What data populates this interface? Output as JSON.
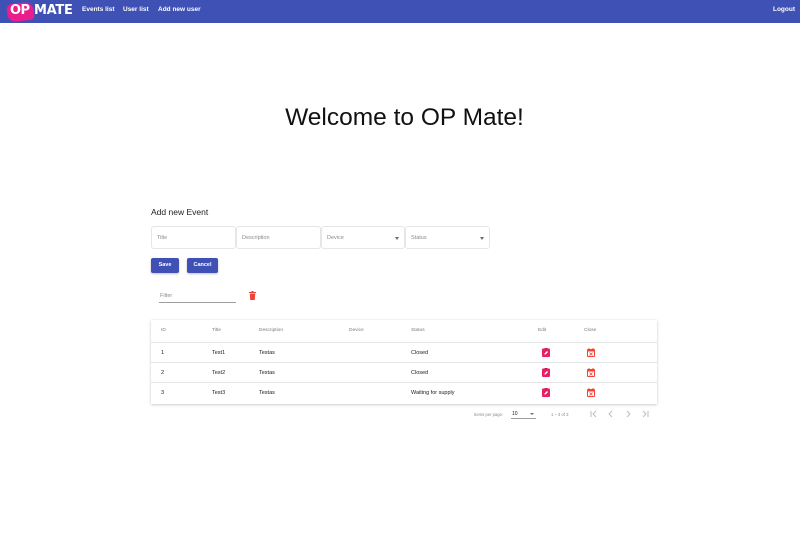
{
  "app": {
    "logo_op": "OP",
    "logo_mate": "MATE"
  },
  "nav": {
    "events_list": "Events list",
    "user_list": "User list",
    "add_new_user": "Add new user",
    "logout": "Logout"
  },
  "welcome": "Welcome to OP Mate!",
  "form": {
    "title": "Add new Event",
    "title_placeholder": "Title",
    "description_placeholder": "Description",
    "device_placeholder": "Device",
    "status_placeholder": "Status",
    "save_label": "Save",
    "cancel_label": "Cancel"
  },
  "filter": {
    "placeholder": "Filter"
  },
  "table": {
    "columns": {
      "id": "ID",
      "title": "Title",
      "description": "Description",
      "device": "Device",
      "status": "Status",
      "edit": "Edit",
      "close": "Close"
    },
    "rows": [
      {
        "id": "1",
        "title": "Test1",
        "description": "Testas",
        "device": "",
        "status": "Closed"
      },
      {
        "id": "2",
        "title": "Test2",
        "description": "Testas",
        "device": "",
        "status": "Closed"
      },
      {
        "id": "3",
        "title": "Test3",
        "description": "Testas",
        "device": "",
        "status": "Waiting for supply"
      }
    ]
  },
  "paginator": {
    "items_per_page_label": "Items per page:",
    "page_size": "10",
    "range_label": "1 – 3 of 3"
  },
  "colors": {
    "primary": "#3f51b5",
    "accent": "#e91e63",
    "warn": "#f44336",
    "logo_blob": "#e91e8c"
  },
  "icons": {
    "edit": "edit-icon",
    "close": "event-busy-icon",
    "delete": "delete-icon",
    "first_page": "first-page-icon",
    "prev_page": "chevron-left-icon",
    "next_page": "chevron-right-icon",
    "last_page": "last-page-icon"
  }
}
